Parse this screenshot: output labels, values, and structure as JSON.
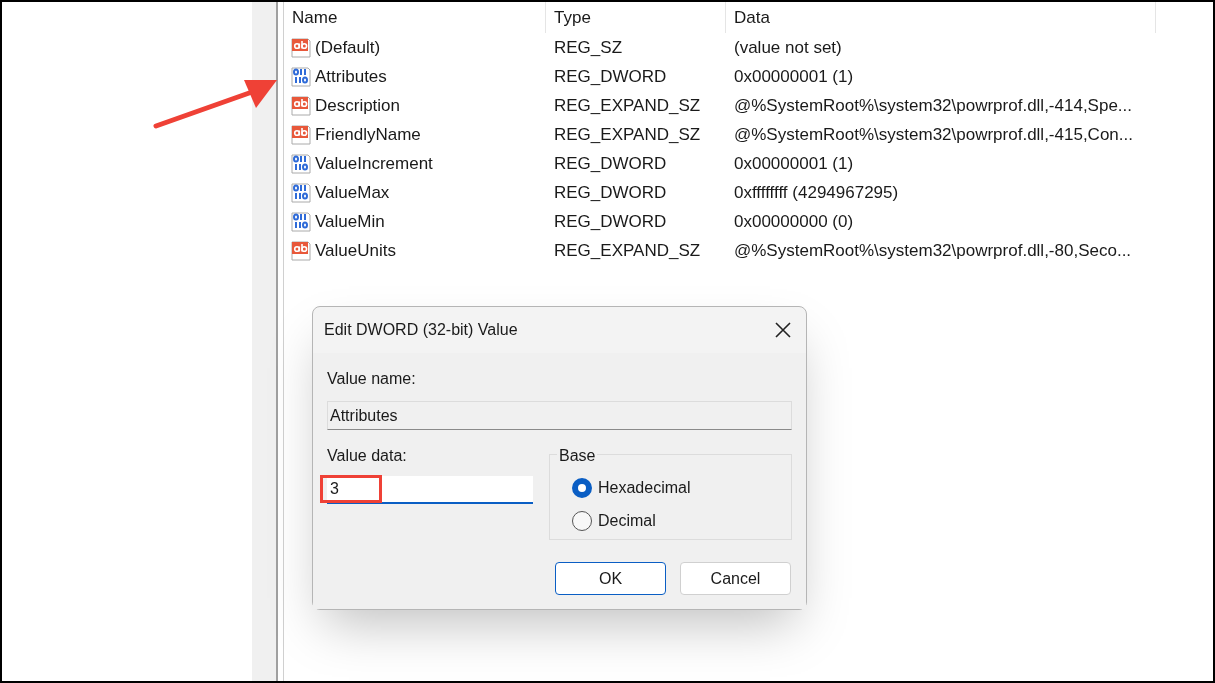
{
  "columns": [
    "Name",
    "Type",
    "Data"
  ],
  "rows": [
    {
      "kind": "string",
      "name": "(Default)",
      "type": "REG_SZ",
      "data": "(value not set)"
    },
    {
      "kind": "dword",
      "name": "Attributes",
      "type": "REG_DWORD",
      "data": "0x00000001 (1)"
    },
    {
      "kind": "string",
      "name": "Description",
      "type": "REG_EXPAND_SZ",
      "data": "@%SystemRoot%\\system32\\powrprof.dll,-414,Spe..."
    },
    {
      "kind": "string",
      "name": "FriendlyName",
      "type": "REG_EXPAND_SZ",
      "data": "@%SystemRoot%\\system32\\powrprof.dll,-415,Con..."
    },
    {
      "kind": "dword",
      "name": "ValueIncrement",
      "type": "REG_DWORD",
      "data": "0x00000001 (1)"
    },
    {
      "kind": "dword",
      "name": "ValueMax",
      "type": "REG_DWORD",
      "data": "0xffffffff (4294967295)"
    },
    {
      "kind": "dword",
      "name": "ValueMin",
      "type": "REG_DWORD",
      "data": "0x00000000 (0)"
    },
    {
      "kind": "string",
      "name": "ValueUnits",
      "type": "REG_EXPAND_SZ",
      "data": "@%SystemRoot%\\system32\\powrprof.dll,-80,Seco..."
    }
  ],
  "dialog": {
    "title": "Edit DWORD (32-bit) Value",
    "value_name_label": "Value name:",
    "value_name": "Attributes",
    "value_data_label": "Value data:",
    "value_data": "3",
    "base_label": "Base",
    "base_options": [
      {
        "label": "Hexadecimal",
        "selected": true
      },
      {
        "label": "Decimal",
        "selected": false
      }
    ],
    "buttons": [
      "OK",
      "Cancel"
    ]
  }
}
